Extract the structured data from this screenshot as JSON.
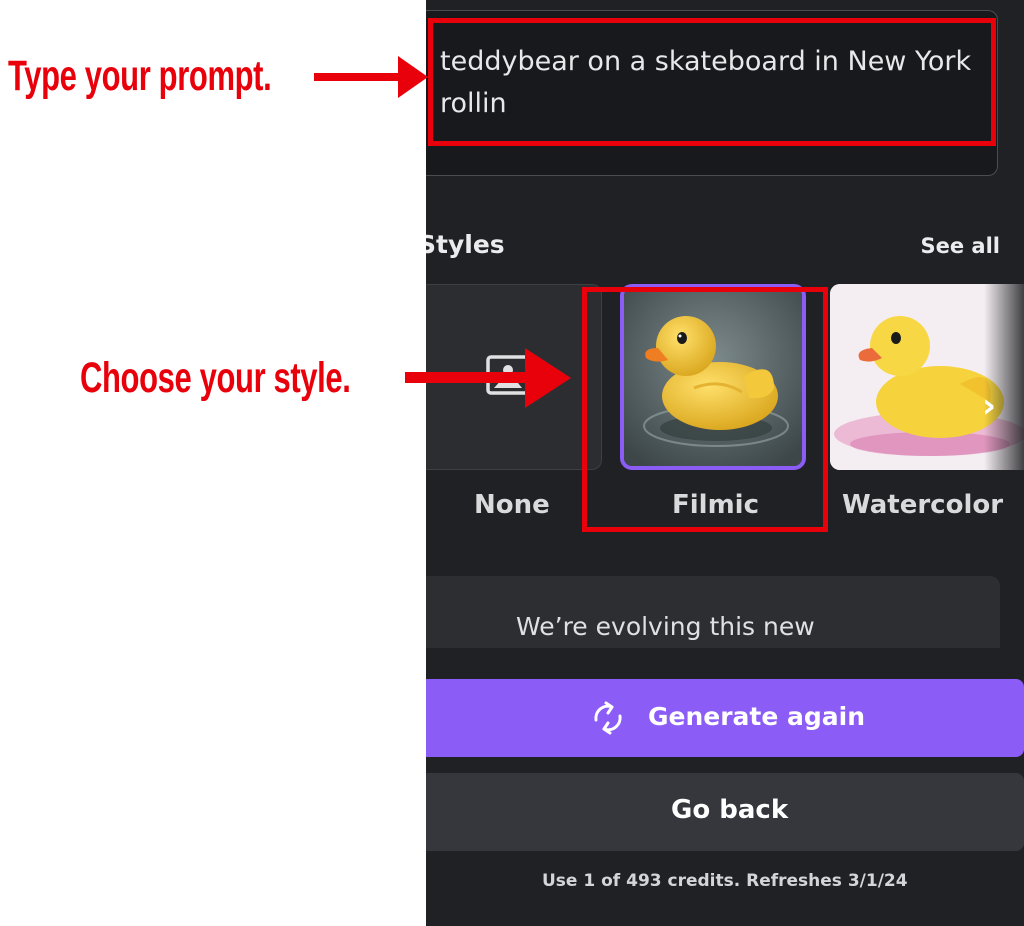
{
  "prompt": {
    "line1": "teddybear on a skateboard in New York",
    "line2": "rollin"
  },
  "styles": {
    "heading": "Styles",
    "see_all": "See all",
    "cards": [
      {
        "label": "None",
        "icon": "image-placeholder-icon",
        "selected": false
      },
      {
        "label": "Filmic",
        "icon": "rubber-duck-photo",
        "selected": true
      },
      {
        "label": "Watercolor",
        "icon": "rubber-duck-watercolor",
        "selected": false
      }
    ],
    "next_icon": "chevron-right-icon"
  },
  "info": {
    "text": "We’re evolving this new"
  },
  "buttons": {
    "generate_label": "Generate again",
    "generate_icon": "refresh-icon",
    "go_back_label": "Go back"
  },
  "credits": "Use 1 of 493 credits. Refreshes 3/1/24",
  "annotations": {
    "prompt_note": "Type your prompt.",
    "style_note": "Choose your style."
  },
  "colors": {
    "panel_bg": "#1f2124",
    "accent": "#8b5cf6",
    "annotation_red": "#e8000b"
  }
}
